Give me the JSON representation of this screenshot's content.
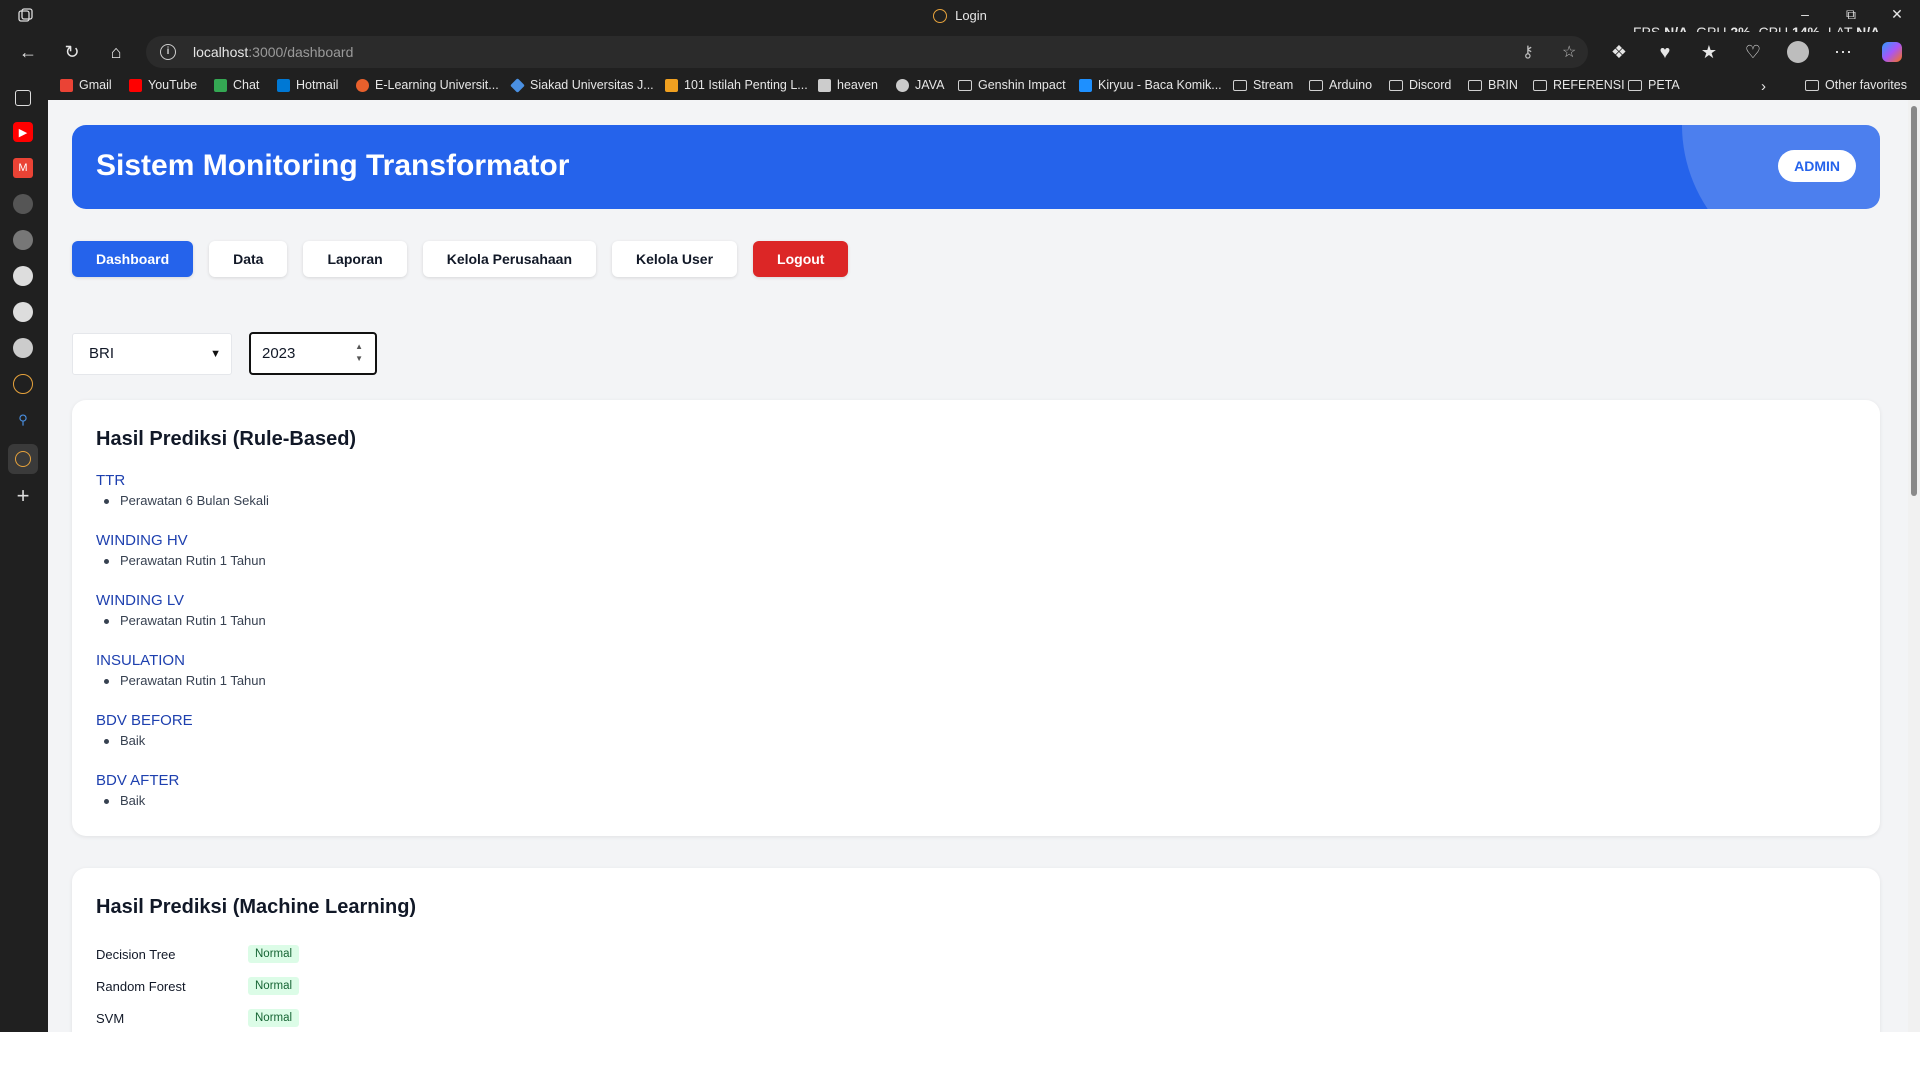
{
  "browser": {
    "tab_title": "Login",
    "url_host": "localhost",
    "url_path": ":3000/dashboard",
    "perf": {
      "fps_label": "FPS",
      "fps_value": "N/A",
      "gpu_label": "GPU",
      "gpu_value": "2%",
      "cpu_label": "CPU",
      "cpu_value": "14%",
      "lat_label": "LAT",
      "lat_value": "N/A"
    },
    "bookmarks": [
      {
        "label": "Gmail",
        "icon": "gmail-icon",
        "color": "#ea4335"
      },
      {
        "label": "YouTube",
        "icon": "youtube-icon",
        "color": "#ff0000"
      },
      {
        "label": "Chat",
        "icon": "chat-icon",
        "color": "#34a853"
      },
      {
        "label": "Hotmail",
        "icon": "outlook-icon",
        "color": "#0078d4"
      },
      {
        "label": "E-Learning Universit...",
        "icon": "elearning-icon",
        "color": "#e8602c"
      },
      {
        "label": "Siakad Universitas J...",
        "icon": "siakad-icon",
        "color": "#4a90e2"
      },
      {
        "label": "101 Istilah Penting L...",
        "icon": "article-icon",
        "color": "#f0a020"
      },
      {
        "label": "heaven",
        "icon": "heaven-icon",
        "color": "#cccccc"
      },
      {
        "label": "JAVA",
        "icon": "java-icon",
        "color": "#cccccc"
      },
      {
        "label": "Genshin Impact",
        "icon": "folder-icon",
        "color": ""
      },
      {
        "label": "Kiryuu - Baca Komik...",
        "icon": "kiryuu-icon",
        "color": "#1e90ff"
      },
      {
        "label": "Stream",
        "icon": "folder-icon",
        "color": ""
      },
      {
        "label": "Arduino",
        "icon": "folder-icon",
        "color": ""
      },
      {
        "label": "Discord",
        "icon": "folder-icon",
        "color": ""
      },
      {
        "label": "BRIN",
        "icon": "folder-icon",
        "color": ""
      },
      {
        "label": "REFERENSI",
        "icon": "folder-icon",
        "color": ""
      },
      {
        "label": "PETA",
        "icon": "folder-icon",
        "color": ""
      }
    ],
    "other_favorites": "Other favorites"
  },
  "page": {
    "header_title": "Sistem Monitoring Transformator",
    "role_badge": "ADMIN",
    "nav": [
      {
        "label": "Dashboard",
        "state": "active"
      },
      {
        "label": "Data",
        "state": "normal"
      },
      {
        "label": "Laporan",
        "state": "normal"
      },
      {
        "label": "Kelola Perusahaan",
        "state": "normal"
      },
      {
        "label": "Kelola User",
        "state": "normal"
      },
      {
        "label": "Logout",
        "state": "danger"
      }
    ],
    "filters": {
      "company": "BRI",
      "year": "2023"
    },
    "rule_based": {
      "title": "Hasil Prediksi (Rule-Based)",
      "items": [
        {
          "param": "TTR",
          "result": "Perawatan 6 Bulan Sekali"
        },
        {
          "param": "WINDING HV",
          "result": "Perawatan Rutin 1 Tahun"
        },
        {
          "param": "WINDING LV",
          "result": "Perawatan Rutin 1 Tahun"
        },
        {
          "param": "INSULATION",
          "result": "Perawatan Rutin 1 Tahun"
        },
        {
          "param": "BDV BEFORE",
          "result": "Baik"
        },
        {
          "param": "BDV AFTER",
          "result": "Baik"
        }
      ]
    },
    "machine_learning": {
      "title": "Hasil Prediksi (Machine Learning)",
      "items": [
        {
          "model": "Decision Tree",
          "status": "Normal"
        },
        {
          "model": "Random Forest",
          "status": "Normal"
        },
        {
          "model": "SVM",
          "status": "Normal"
        }
      ]
    }
  },
  "colors": {
    "primary": "#2563eb",
    "danger": "#dc2626",
    "badge_bg": "#dcfce7",
    "badge_fg": "#166534",
    "param": "#1e40af"
  }
}
